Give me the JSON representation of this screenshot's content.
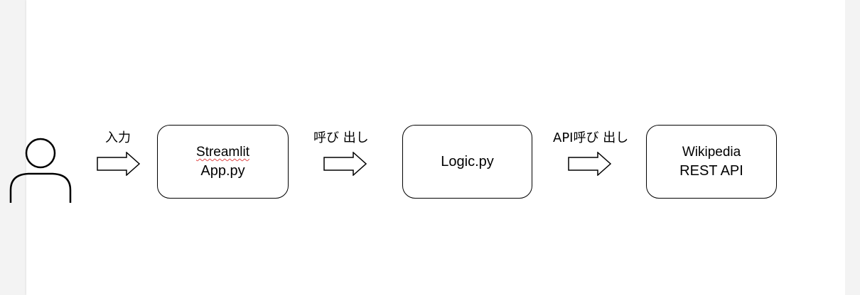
{
  "diagram": {
    "user": {
      "icon": "person-icon"
    },
    "arrows": {
      "icon": "right-arrow-icon",
      "labels": {
        "input": "入力",
        "call": "呼び 出し",
        "api_call": "API呼び 出し"
      }
    },
    "boxes": {
      "app": {
        "line1": "Streamlit",
        "line2": "App.py"
      },
      "logic": {
        "line1": "Logic.py"
      },
      "wiki": {
        "line1": "Wikipedia",
        "line2": "REST API"
      }
    }
  }
}
